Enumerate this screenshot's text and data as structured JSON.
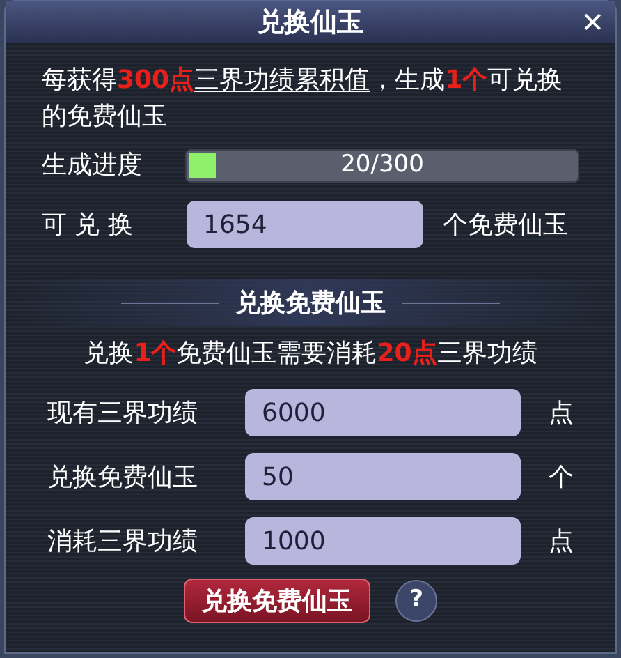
{
  "window": {
    "title": "兑换仙玉",
    "close": "✕"
  },
  "description": [
    {
      "text": "每获得",
      "kind": "plain"
    },
    {
      "text": "300点",
      "kind": "highlight"
    },
    {
      "text": "三界功绩累积值",
      "kind": "underline"
    },
    {
      "text": "，生成",
      "kind": "plain"
    },
    {
      "text": "1个",
      "kind": "highlight"
    },
    {
      "text": "可兑换的免费仙玉",
      "kind": "plain"
    }
  ],
  "progress": {
    "label": "生成进度",
    "level": 0.067,
    "reading": "20/300"
  },
  "available": {
    "label": "可 兑 换",
    "value": "1654",
    "unit": "个免费仙玉"
  },
  "section": {
    "title": "兑换免费仙玉",
    "rule": [
      {
        "text": "兑换",
        "kind": "plain"
      },
      {
        "text": "1个",
        "kind": "highlight"
      },
      {
        "text": "免费仙玉需要消耗",
        "kind": "plain"
      },
      {
        "text": "20点",
        "kind": "highlight"
      },
      {
        "text": "三界功绩",
        "kind": "plain"
      }
    ],
    "fields": [
      {
        "label": "现有三界功绩",
        "value": "6000",
        "unit": "点"
      },
      {
        "label": "兑换免费仙玉",
        "value": "50",
        "unit": "个"
      },
      {
        "label": "消耗三界功绩",
        "value": "1000",
        "unit": "点"
      }
    ],
    "button": "兑换免费仙玉",
    "help": "?"
  }
}
